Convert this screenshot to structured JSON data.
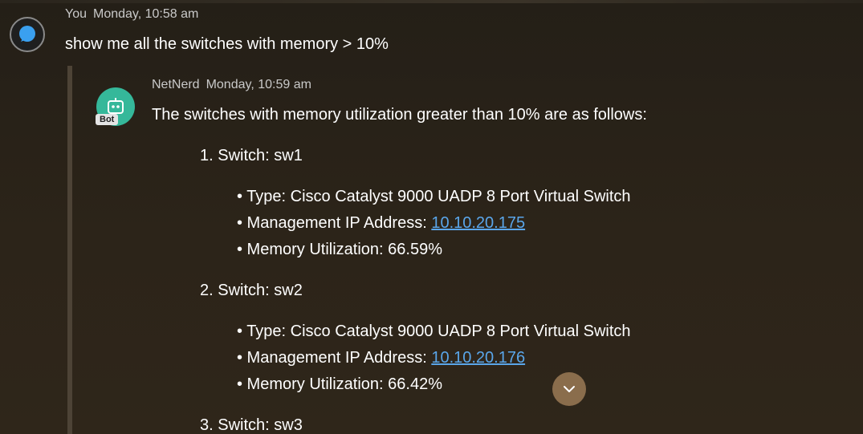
{
  "user_message": {
    "author": "You",
    "timestamp": "Monday, 10:58 am",
    "text": "show me all the switches with memory > 10%"
  },
  "bot_message": {
    "author": "NetNerd",
    "timestamp": "Monday, 10:59 am",
    "badge": "Bot",
    "intro": "The switches with memory utilization greater than 10% are as follows:",
    "switches": [
      {
        "heading": "1. Switch: sw1",
        "type": "• Type: Cisco Catalyst 9000 UADP 8 Port Virtual Switch",
        "ip_label": "• Management IP Address: ",
        "ip": "10.10.20.175",
        "memory": "• Memory Utilization: 66.59%"
      },
      {
        "heading": "2. Switch: sw2",
        "type": "• Type: Cisco Catalyst 9000 UADP 8 Port Virtual Switch",
        "ip_label": "• Management IP Address: ",
        "ip": "10.10.20.176",
        "memory": "• Memory Utilization: 66.42%"
      },
      {
        "heading": "3. Switch: sw3"
      }
    ]
  },
  "colors": {
    "link": "#5aa6ea",
    "bot_avatar": "#35b89a",
    "scroll_button": "#8a6d4c"
  },
  "icons": {
    "user_avatar": "chat-bubble-icon",
    "bot_avatar": "robot-icon",
    "scroll": "chevron-down-icon"
  }
}
